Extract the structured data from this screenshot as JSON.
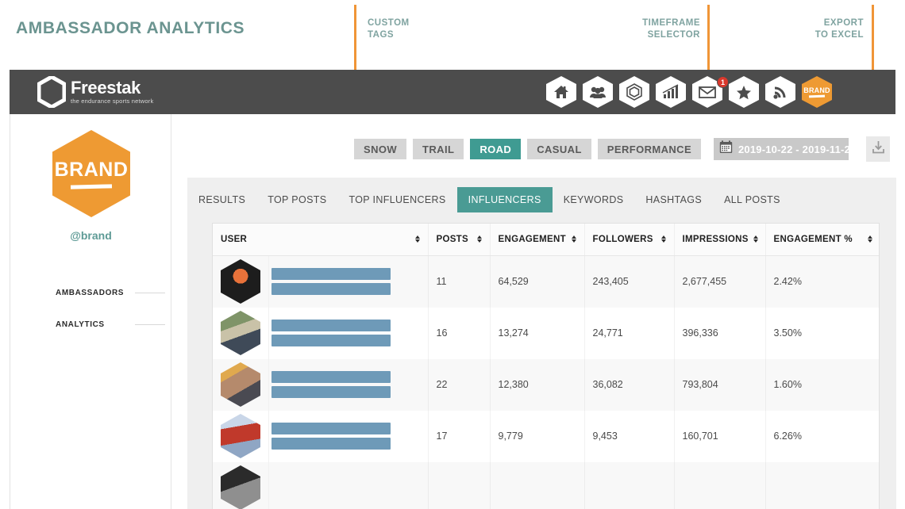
{
  "annotation": {
    "title": "AMBASSADOR ANALYTICS",
    "callouts": [
      {
        "label": "CUSTOM\nTAGS"
      },
      {
        "label": "TIMEFRAME\nSELECTOR"
      },
      {
        "label": "EXPORT\nTO EXCEL"
      }
    ],
    "line_color": "#F09537",
    "label_color": "#7fa3a0",
    "title_color": "#6b9490"
  },
  "header": {
    "logo_word": "Freestak",
    "logo_tagline": "the endurance sports network",
    "icons": [
      {
        "name": "home-icon",
        "badge": null
      },
      {
        "name": "people-icon",
        "badge": null
      },
      {
        "name": "hexagon-ring-icon",
        "badge": null
      },
      {
        "name": "chart-icon",
        "badge": null
      },
      {
        "name": "envelope-icon",
        "badge": "1"
      },
      {
        "name": "star-icon",
        "badge": null
      },
      {
        "name": "rss-icon",
        "badge": null
      },
      {
        "name": "brand-hexagon-icon",
        "badge": null
      }
    ],
    "brand_hex_label": "BRAND",
    "background": "#4c4c4c",
    "badge_color": "#D9382C"
  },
  "sidebar": {
    "brand_hex_label": "BRAND",
    "handle": "@brand",
    "handle_color": "#5E9B96",
    "brand_color": "#EE9A33",
    "nav": [
      {
        "label": "AMBASSADORS"
      },
      {
        "label": "ANALYTICS"
      }
    ]
  },
  "filters": {
    "tags": [
      {
        "label": "SNOW",
        "active": false
      },
      {
        "label": "TRAIL",
        "active": false
      },
      {
        "label": "ROAD",
        "active": true
      },
      {
        "label": "CASUAL",
        "active": false
      },
      {
        "label": "PERFORMANCE",
        "active": false
      }
    ],
    "active_color": "#3F9B92",
    "daterange": {
      "icon": "calendar-icon",
      "value": "2019-10-22 - 2019-11-2"
    },
    "export": {
      "icon": "download-icon"
    }
  },
  "tabs": [
    {
      "label": "RESULTS",
      "active": false
    },
    {
      "label": "TOP POSTS",
      "active": false
    },
    {
      "label": "TOP INFLUENCERS",
      "active": false
    },
    {
      "label": "INFLUENCERS",
      "active": true
    },
    {
      "label": "KEYWORDS",
      "active": false
    },
    {
      "label": "HASHTAGS",
      "active": false
    },
    {
      "label": "ALL POSTS",
      "active": false
    }
  ],
  "table": {
    "columns": [
      {
        "label": "USER",
        "sortable": true
      },
      {
        "label": "POSTS",
        "sortable": true
      },
      {
        "label": "ENGAGEMENT",
        "sortable": true
      },
      {
        "label": "FOLLOWERS",
        "sortable": true
      },
      {
        "label": "IMPRESSIONS",
        "sortable": true
      },
      {
        "label": "ENGAGEMENT %",
        "sortable": true
      }
    ],
    "rows": [
      {
        "user_redacted": true,
        "avatar": "athlete-orange-vest",
        "posts": "11",
        "engagement": "64,529",
        "followers": "243,405",
        "impressions": "2,677,455",
        "engagement_pct": "2.42%"
      },
      {
        "user_redacted": true,
        "avatar": "athlete-cap-trail",
        "posts": "16",
        "engagement": "13,274",
        "followers": "24,771",
        "impressions": "396,336",
        "engagement_pct": "3.50%"
      },
      {
        "user_redacted": true,
        "avatar": "athlete-sunglasses",
        "posts": "22",
        "engagement": "12,380",
        "followers": "36,082",
        "impressions": "793,804",
        "engagement_pct": "1.60%"
      },
      {
        "user_redacted": true,
        "avatar": "athlete-red-kit",
        "posts": "17",
        "engagement": "9,779",
        "followers": "9,453",
        "impressions": "160,701",
        "engagement_pct": "6.26%"
      }
    ],
    "redaction_color": "#6E9AB8"
  }
}
